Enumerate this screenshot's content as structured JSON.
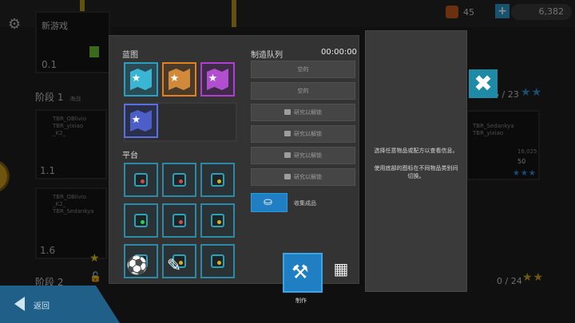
{
  "background": {
    "new_game_label": "新游戏",
    "level_01": "0.1",
    "resources": {
      "gem_count": "45",
      "currency": "6,382"
    },
    "stage1": {
      "title": "阶段 1",
      "subtitle": "海战",
      "progress": "6 / 23"
    },
    "stage2": {
      "title": "阶段 2",
      "progress": "0 / 24"
    },
    "cards": [
      {
        "level": "1.1",
        "players": [
          "TBR_OBlivio",
          "TBR_yixiao",
          "_K2_"
        ]
      },
      {
        "level": "1.6",
        "players": [
          "TBR_OBlivio",
          "_K2_",
          "TBR_Sedankya"
        ]
      },
      {
        "score": "16,025",
        "count": "50",
        "players": [
          "TBR_Sedankya",
          "TBR_yixiao"
        ]
      }
    ],
    "back_label": "返回"
  },
  "panel": {
    "blueprints_label": "蓝图",
    "platforms_label": "平台",
    "blueprints": [
      {
        "color": "#2a9fbf",
        "fill": "#3bb5d4"
      },
      {
        "color": "#e0821e",
        "fill": "#d18a3a"
      },
      {
        "color": "#b03fcf",
        "fill": "#b24fd0"
      },
      {
        "color": "#5a6fe0",
        "fill": "#4c5fc9"
      }
    ],
    "platform_dots": [
      "#d04a4a",
      "#d04a4a",
      "#d6b020",
      "#2ecf4a",
      "#d04a4a",
      "#d6b020",
      "#d04a4a",
      "#d6b020",
      "#d6b020"
    ],
    "tools": [
      "ball-icon",
      "pen-icon"
    ]
  },
  "queue": {
    "title": "制造队列",
    "timer": "00:00:00",
    "slots": [
      {
        "text": "空的",
        "locked": false
      },
      {
        "text": "空的",
        "locked": false
      },
      {
        "text": "研究以解锁",
        "locked": true
      },
      {
        "text": "研究以解锁",
        "locked": true
      },
      {
        "text": "研究以解锁",
        "locked": true
      },
      {
        "text": "研究以解锁",
        "locked": true
      }
    ],
    "collect_label": "收集成品"
  },
  "info": {
    "line1": "选择任意物品或配方以查看信息。",
    "line2": "使用底部的图标在不同物品类别间切换。"
  },
  "tabs": {
    "craft_label": "制作"
  },
  "colors": {
    "accent": "#1f7fc2",
    "close": "#1f8aa6",
    "panel": "#333333"
  }
}
